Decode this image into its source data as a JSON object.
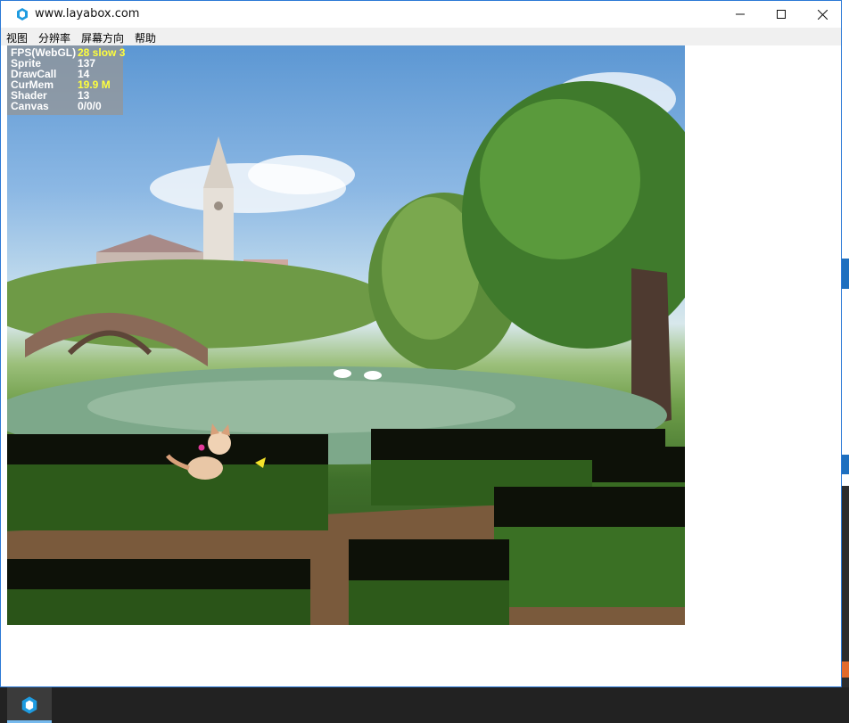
{
  "window": {
    "title": "www.layabox.com",
    "icon": "laya-hex-icon",
    "controls": [
      "minimize-icon",
      "maximize-icon",
      "close-icon"
    ]
  },
  "menu": {
    "items": [
      "视图",
      "分辨率",
      "屏幕方向",
      "帮助"
    ]
  },
  "stats": [
    {
      "key": "FPS(WebGL)",
      "value": "28 slow 3",
      "highlight": true
    },
    {
      "key": "Sprite",
      "value": "137",
      "highlight": false
    },
    {
      "key": "DrawCall",
      "value": "14",
      "highlight": false
    },
    {
      "key": "CurMem",
      "value": "19.9 M",
      "highlight": true
    },
    {
      "key": "Shader",
      "value": "13",
      "highlight": false
    },
    {
      "key": "Canvas",
      "value": "0/0/0",
      "highlight": false
    }
  ],
  "colors": {
    "accent": "#2b79d6",
    "stat_highlight": "#ffff3c",
    "taskbar": "#222222"
  },
  "taskbar": {
    "items": [
      "laya-hex-icon"
    ]
  }
}
